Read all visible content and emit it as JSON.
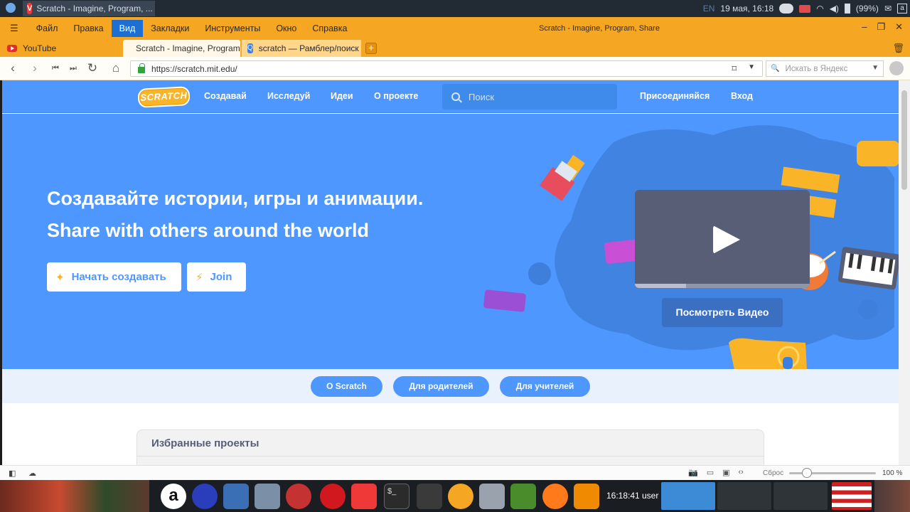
{
  "system": {
    "window_task_title": "Scratch - Imagine, Program, ...",
    "lang": "EN",
    "datetime": "19 мая, 16:18",
    "battery": "(99%)"
  },
  "browser": {
    "menu": [
      "Файл",
      "Правка",
      "Вид",
      "Закладки",
      "Инструменты",
      "Окно",
      "Справка"
    ],
    "active_menu_index": 2,
    "window_title": "Scratch - Imagine, Program, Share",
    "tabs": [
      {
        "label": "YouTube",
        "icon": "youtube-icon"
      },
      {
        "label": "Scratch - Imagine, Program",
        "icon": "scratch-icon"
      },
      {
        "label": "scratch — Рамблер/поиск",
        "icon": "rambler-icon"
      }
    ],
    "active_tab_index": 1,
    "url": "https://scratch.mit.edu/",
    "search_placeholder": "Искать в Яндекс"
  },
  "scratch": {
    "logo": "SCRATCH",
    "nav": [
      "Создавай",
      "Исследуй",
      "Идеи",
      "О проекте"
    ],
    "search_placeholder": "Поиск",
    "join": "Присоединяйся",
    "signin": "Вход",
    "hero_title": "Создавайте истории, игры и анимации.",
    "hero_subtitle": "Share with others around the world",
    "start_button": "Начать создавать",
    "join_button": "Join",
    "watch_video": "Посмотреть Видео",
    "subnav": [
      "О Scratch",
      "Для родителей",
      "Для учителей"
    ],
    "featured_title": "Избранные проекты"
  },
  "statusbar": {
    "reset": "Сброс",
    "zoom": "100 %"
  },
  "taskbar": {
    "clock": "16:18:41",
    "user": "user"
  },
  "colors": {
    "scratch_blue": "#4d97ff",
    "browser_orange": "#f5a623",
    "scratch_yellow": "#f9b428"
  }
}
